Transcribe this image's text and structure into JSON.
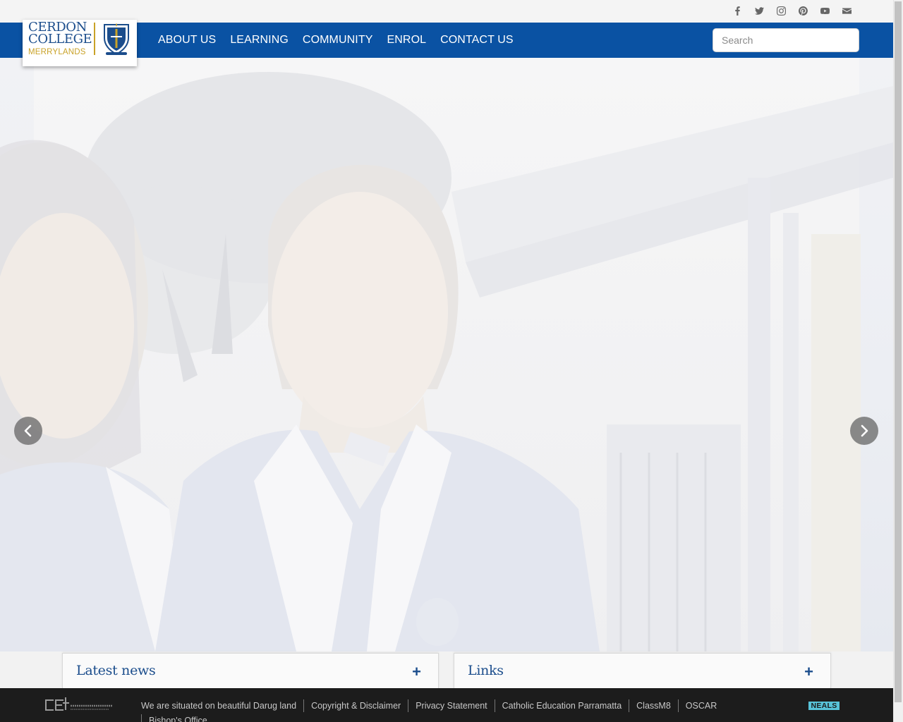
{
  "social": {
    "icons": [
      "facebook-icon",
      "twitter-icon",
      "instagram-icon",
      "pinterest-icon",
      "youtube-icon",
      "email-icon"
    ]
  },
  "logo": {
    "line1": "CERDON",
    "line2": "COLLEGE",
    "line3": "MERRYLANDS"
  },
  "nav": {
    "items": [
      "ABOUT US",
      "LEARNING",
      "COMMUNITY",
      "ENROL",
      "CONTACT US"
    ]
  },
  "search": {
    "placeholder": "Search",
    "value": ""
  },
  "carousel": {
    "prev_icon": "chevron-left-icon",
    "next_icon": "chevron-right-icon"
  },
  "panels": {
    "news_title": "Latest news",
    "news_toggle": "+",
    "links_title": "Links",
    "links_toggle": "+"
  },
  "footer": {
    "acknowledgement": "We are situated on beautiful Darug land",
    "links": [
      "Copyright & Disclaimer",
      "Privacy Statement",
      "Catholic Education Parramatta",
      "ClassM8",
      "OSCAR",
      "Bishop's Office"
    ],
    "partner_logo": "NEALS"
  },
  "colors": {
    "brand_blue": "#0a52a3",
    "brand_gold": "#c9a227",
    "footer_bg": "#1c1c1c"
  }
}
